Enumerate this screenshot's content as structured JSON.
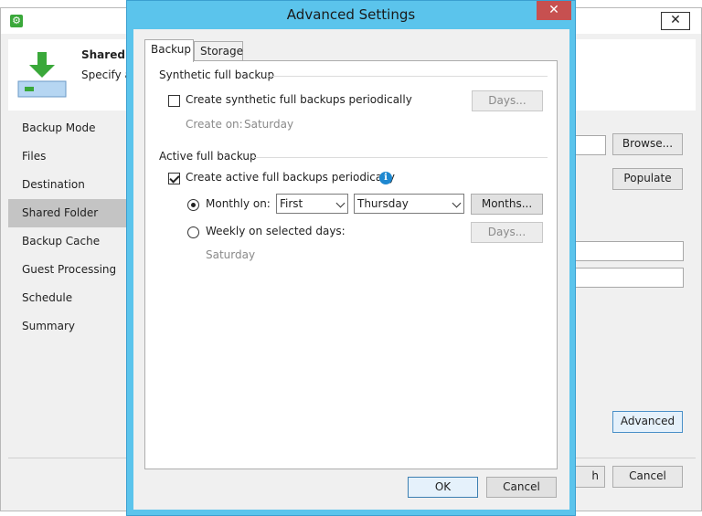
{
  "background": {
    "header": {
      "title": "Shared F",
      "subtitle": "Specify a"
    },
    "nav": [
      {
        "label": "Backup Mode"
      },
      {
        "label": "Files"
      },
      {
        "label": "Destination"
      },
      {
        "label": "Shared Folder"
      },
      {
        "label": "Backup Cache"
      },
      {
        "label": "Guest Processing"
      },
      {
        "label": "Schedule"
      },
      {
        "label": "Summary"
      }
    ],
    "buttons": {
      "browse": "Browse...",
      "populate": "Populate",
      "advanced": "Advanced",
      "finish_partial": "h",
      "cancel": "Cancel"
    },
    "close_glyph": "✕"
  },
  "dialog": {
    "title": "Advanced Settings",
    "close_glyph": "✕",
    "tabs": [
      {
        "label": "Backup"
      },
      {
        "label": "Storage"
      }
    ],
    "synthetic": {
      "group_label": "Synthetic full backup",
      "checkbox_label": "Create synthetic full backups periodically",
      "checked": false,
      "days_button": "Days...",
      "create_on_label": "Create on:",
      "create_on_value": "Saturday"
    },
    "active": {
      "group_label": "Active full backup",
      "checkbox_label": "Create active full backups periodically",
      "checked": true,
      "monthly_label": "Monthly on:",
      "monthly_selected": true,
      "monthly_week": "First",
      "monthly_day": "Thursday",
      "months_button": "Months...",
      "weekly_label": "Weekly on selected days:",
      "weekly_selected": false,
      "days_button": "Days...",
      "weekly_value": "Saturday"
    },
    "ok_button": "OK",
    "cancel_button": "Cancel"
  },
  "colors": {
    "dialog_frame": "#5bc4ec",
    "close_button": "#c75050",
    "info_icon": "#1e88d0",
    "selected_nav": "#c4c4c4",
    "app_icon": "#3aa83a"
  }
}
